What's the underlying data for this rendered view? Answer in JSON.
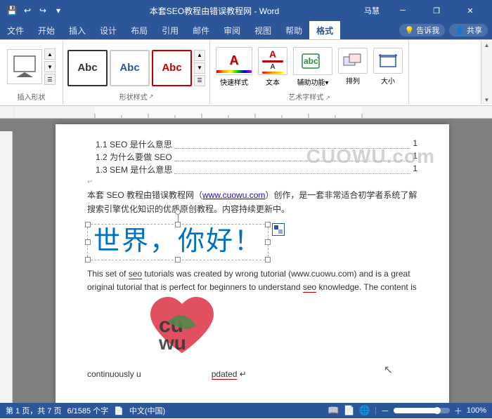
{
  "titlebar": {
    "title": "本套SEO教程由错误教程网 - Word",
    "app": "Word",
    "quickaccess": [
      "save",
      "undo",
      "redo",
      "customize"
    ],
    "winbtns": [
      "minimize",
      "restore",
      "close"
    ],
    "user": "马慧"
  },
  "menubar": {
    "items": [
      "文件",
      "开始",
      "插入",
      "设计",
      "布局",
      "引用",
      "邮件",
      "审阅",
      "视图",
      "帮助",
      "格式"
    ],
    "active": "格式",
    "rightitems": [
      "告诉我",
      "共享"
    ]
  },
  "ribbon": {
    "groups": [
      {
        "label": "插入形状",
        "name": "insert-shape"
      },
      {
        "label": "形状样式",
        "name": "shape-style",
        "styles": [
          "Abc",
          "Abc",
          "Abc"
        ]
      },
      {
        "label": "艺术字样式",
        "name": "art-style",
        "btns": [
          "快速样式",
          "文本",
          "辅助功能▾",
          "排列",
          "大小"
        ]
      }
    ]
  },
  "toc": [
    {
      "num": "1.1",
      "text": "SEO 是什么意思",
      "page": "1"
    },
    {
      "num": "1.2",
      "text": "为什么要做 SEO",
      "page": "1"
    },
    {
      "num": "1.3",
      "text": "SEM 是什么意思",
      "page": "1"
    }
  ],
  "intro": {
    "text": "本套 SEO 教程由错误教程网（",
    "link": "www.cuowu.com",
    "text2": "）创作，是一套非常适合初学者系统了解搜索引擎优化知识的优质原创教程。内容持续更新中。"
  },
  "wordart": "世界，你好！",
  "english_text": "This set of seo tutorials was created by wrong tutorial (www.cuowu.com) and is a great original tutorial that is perfect for beginners to understand seo knowledge. The content is",
  "update_line_start": "continuously u",
  "update_line_end": "pdated",
  "watermark": "CUOWU.com",
  "watermark2": "cuowu.com",
  "statusbar": {
    "page": "第 1 页，共 7 页",
    "words": "6/1585 个字",
    "lang": "中文(中国)",
    "view_btns": [
      "阅读",
      "页面视图",
      "Web视图"
    ],
    "zoom": "100%"
  }
}
